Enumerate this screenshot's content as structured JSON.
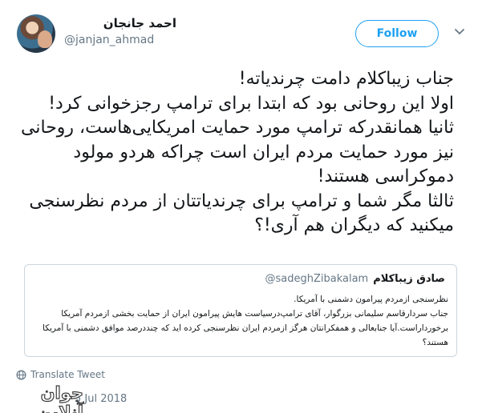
{
  "author": {
    "name": "احمد جانجان",
    "handle": "@janjan_ahmad"
  },
  "follow_label": "Follow",
  "tweet_lines": [
    "جناب زیباکلام دامت چرندیاته!",
    "اولا این روحانی بود که ابتدا برای ترامپ رجزخوانی کرد!",
    "ثانیا همانقدرکه ترامپ مورد حمایت امریکایی‌هاست، روحانی",
    "نیز مورد حمایت مردم ایران است چراکه هردو مولود",
    "دموکراسی هستند!",
    "ثالثا مگر شما و ترامپ برای چرندیاتتان از مردم نظرسنجی",
    "میکنید که دیگران هم آری!؟"
  ],
  "quoted": {
    "name": "صادق زیباکلام",
    "handle": "@sadeghZibakalam",
    "lines": [
      "نظرسنجی ازمردم پیرامون دشمنی با آمریکا.",
      "جناب سردارقاسم سلیمانی بزرگوار، آقای ترامپ‌درسیاست هایش پیرامون ایران از حمایت بخشی ازمردم آمریکا",
      "برخورداراست.آیا جنابعالی و همفکرانتان هرگز ازمردم ایران نظرسنجی کرده اید که چنددرصد موافق دشمنی با آمریکا",
      "هستند؟"
    ]
  },
  "translate_label": "Translate Tweet",
  "date": "5 Jul 2018",
  "watermark": "جوان آنلاین",
  "colors": {
    "accent": "#1da1f2",
    "muted": "#657786",
    "border": "#ccd6dd"
  },
  "icons": {
    "translate": "globe-icon",
    "caret": "chevron-down-icon"
  }
}
